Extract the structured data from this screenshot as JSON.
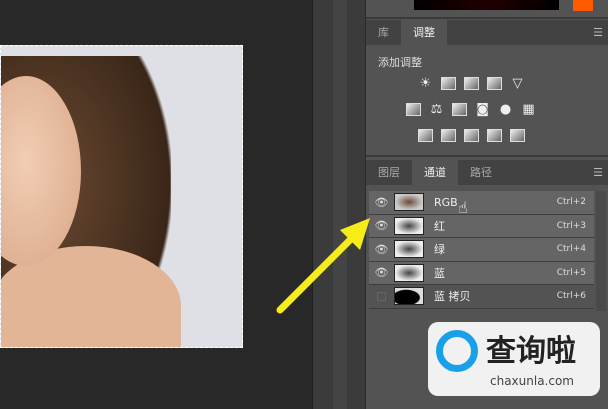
{
  "panel": {
    "top_tabs": [
      {
        "label": "库"
      },
      {
        "label": "调整"
      }
    ],
    "adjustments": {
      "title": "添加调整",
      "row1": [
        "brightness-contrast-icon",
        "levels-icon",
        "curves-icon",
        "exposure-icon",
        "vibrance-icon"
      ],
      "row2": [
        "hue-saturation-icon",
        "color-balance-icon",
        "black-white-icon",
        "photo-filter-icon",
        "channel-mixer-icon",
        "color-lookup-icon"
      ],
      "row3": [
        "invert-icon",
        "posterize-icon",
        "threshold-icon",
        "selective-color-icon",
        "gradient-map-icon"
      ]
    },
    "channel_tabs": [
      {
        "label": "图层"
      },
      {
        "label": "通道"
      },
      {
        "label": "路径"
      }
    ],
    "channels": [
      {
        "name": "RGB",
        "shortcut": "Ctrl+2",
        "visible": true
      },
      {
        "name": "红",
        "shortcut": "Ctrl+3",
        "visible": true
      },
      {
        "name": "绿",
        "shortcut": "Ctrl+4",
        "visible": true
      },
      {
        "name": "蓝",
        "shortcut": "Ctrl+5",
        "visible": true
      },
      {
        "name": "蓝 拷贝",
        "shortcut": "Ctrl+6",
        "visible": false
      }
    ]
  },
  "watermark": {
    "text": "查询啦",
    "url": "chaxunla.com"
  },
  "colors": {
    "accent_arrow": "#f5ec1a",
    "panel": "#535353",
    "foreground": "#ff5a00"
  }
}
